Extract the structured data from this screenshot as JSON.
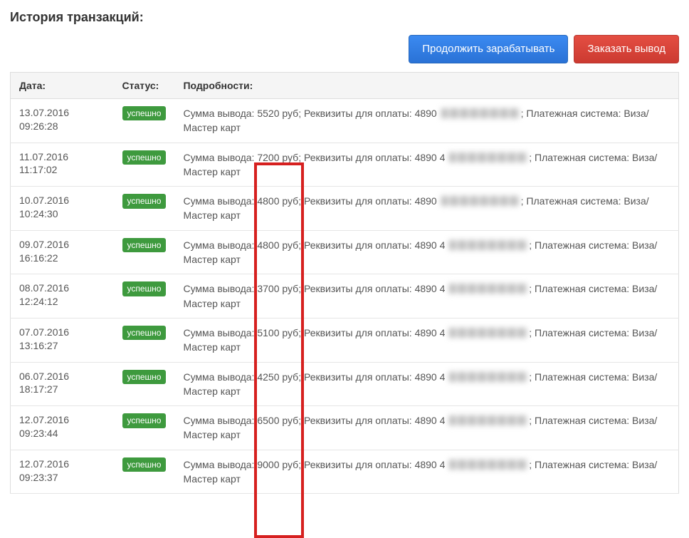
{
  "heading": "История транзакций:",
  "actions": {
    "continue_label": "Продолжить зарабатывать",
    "withdraw_label": "Заказать вывод"
  },
  "table": {
    "headers": {
      "date": "Дата:",
      "status": "Статус:",
      "details": "Подробности:"
    },
    "status_label": "успешно",
    "detail_parts": {
      "prefix": "Сумма вывода: ",
      "currency": " руб",
      "requisites": "; Реквизиты для оплаты: ",
      "system": "; Платежная система: Виза/Мастер карт"
    },
    "rows": [
      {
        "date": "13.07.2016\n09:26:28",
        "amount": "5520",
        "card": "4890"
      },
      {
        "date": "11.07.2016\n11:17:02",
        "amount": "7200",
        "card": "4890 4"
      },
      {
        "date": "10.07.2016\n10:24:30",
        "amount": "4800",
        "card": "4890"
      },
      {
        "date": "09.07.2016\n16:16:22",
        "amount": "4800",
        "card": "4890 4"
      },
      {
        "date": "08.07.2016\n12:24:12",
        "amount": "3700",
        "card": "4890 4"
      },
      {
        "date": "07.07.2016\n13:16:27",
        "amount": "5100",
        "card": "4890 4"
      },
      {
        "date": "06.07.2016\n18:17:27",
        "amount": "4250",
        "card": "4890 4"
      },
      {
        "date": "12.07.2016\n09:23:44",
        "amount": "6500",
        "card": "4890 4"
      },
      {
        "date": "12.07.2016\n09:23:37",
        "amount": "9000",
        "card": "4890 4"
      }
    ]
  }
}
